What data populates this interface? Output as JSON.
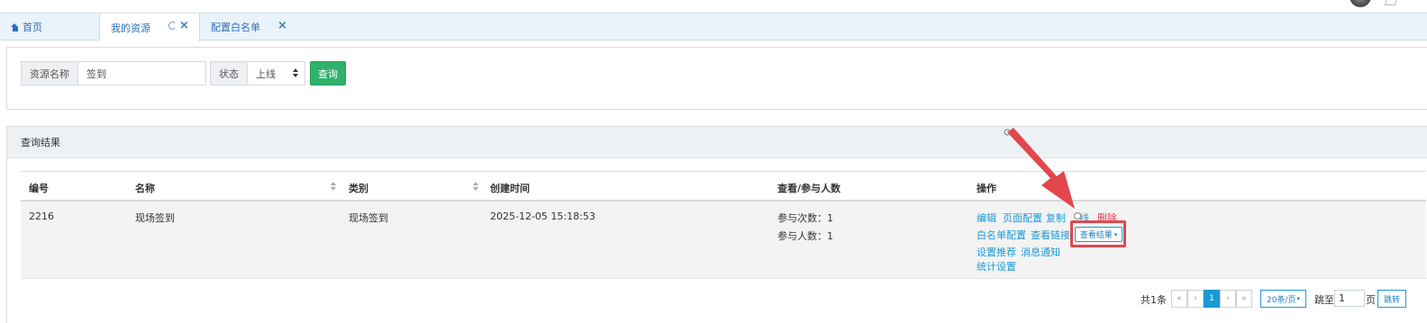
{
  "tabs": {
    "home": "首页",
    "my_resources": "我的资源",
    "whitelist": "配置白名单"
  },
  "search": {
    "name_label": "资源名称",
    "name_value": "签到",
    "status_label": "状态",
    "status_value": "上线",
    "query_button": "查询"
  },
  "results": {
    "title": "查询结果",
    "columns": [
      "编号",
      "名称",
      "类别",
      "创建时间",
      "查看/参与人数",
      "操作"
    ],
    "rows": [
      {
        "id": "2216",
        "name": "现场签到",
        "category": "现场签到",
        "created": "2025-12-05 15:18:53",
        "participation_count": "参与次数：1",
        "participant_count": "参与人数：1",
        "actions": {
          "edit": "编辑",
          "page_config": "页面配置",
          "copy": "复制",
          "offline": "线",
          "delete": "删除",
          "whitelist_config": "白名单配置",
          "view_link": "查看链接",
          "view_result": "查看结果",
          "set_recommend": "设置推荐",
          "message_notify": "消息通知",
          "stats_settings": "统计设置"
        }
      }
    ]
  },
  "pagination": {
    "total": "共1条",
    "first": "«",
    "prev": "‹",
    "current": "1",
    "next": "›",
    "last": "»",
    "page_size": "20条/页",
    "jump_label": "跳至",
    "jump_value": "1",
    "page_label": "页",
    "jump_button": "跳转"
  },
  "colors": {
    "link": "#1a9ad6",
    "primary_green": "#2fb26b",
    "danger": "#e8384f",
    "annotation_red": "#e2474c"
  }
}
